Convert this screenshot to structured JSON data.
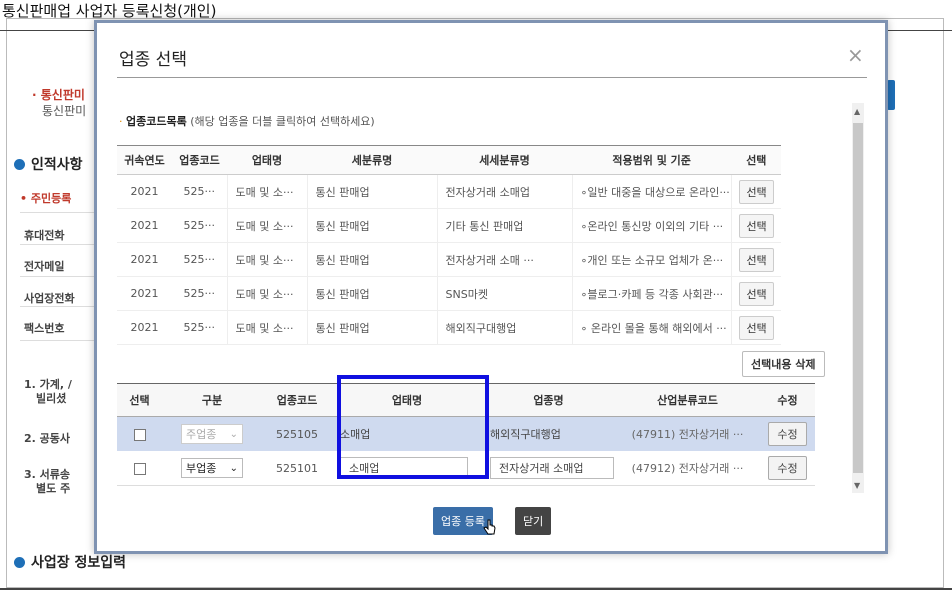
{
  "page": {
    "title": "통신판매업 사업자 등록신청(개인)",
    "bullet_red": "· 통신판미",
    "sub_text": "통신판미",
    "section_personal": "인적사항",
    "field_resident": "• 주민등록",
    "field_mobile": "휴대전화",
    "field_email": "전자메일",
    "field_phone": "사업장전화",
    "field_fax": "팩스번호",
    "note1": "1. 가계, /",
    "note1b": "빌리셨",
    "note2": "2. 공동사",
    "note3": "3. 서류송",
    "note3b": "별도 주",
    "section_business": "사업장 정보입력"
  },
  "modal": {
    "title": "업종 선택",
    "close_symbol": "×",
    "list_label": "업종코드목록",
    "list_hint": "(해당 업종을 더블 클릭하여 선택하세요)",
    "top_headers": [
      "귀속연도",
      "업종코드",
      "업태명",
      "세분류명",
      "세세분류명",
      "적용범위 및 기준",
      "선택"
    ],
    "top_rows": [
      {
        "year": "2021",
        "code": "525···",
        "type": "도매 및 소···",
        "sub": "통신 판매업",
        "subsub": "전자상거래 소매업",
        "scope": "∘일반 대중을 대상으로 온라인···",
        "btn": "선택"
      },
      {
        "year": "2021",
        "code": "525···",
        "type": "도매 및 소···",
        "sub": "통신 판매업",
        "subsub": "기타 통신 판매업",
        "scope": "∘온라인 통신망 이외의 기타 ···",
        "btn": "선택"
      },
      {
        "year": "2021",
        "code": "525···",
        "type": "도매 및 소···",
        "sub": "통신 판매업",
        "subsub": "전자상거래 소매 ···",
        "scope": "∘개인 또는 소규모 업체가 온···",
        "btn": "선택"
      },
      {
        "year": "2021",
        "code": "525···",
        "type": "도매 및 소···",
        "sub": "통신 판매업",
        "subsub": "SNS마켓",
        "scope": "∘블로그·카페 등 각종 사회관···",
        "btn": "선택"
      },
      {
        "year": "2021",
        "code": "525···",
        "type": "도매 및 소···",
        "sub": "통신 판매업",
        "subsub": "해외직구대행업",
        "scope": "∘ 온라인 몰을 통해 해외에서 ···",
        "btn": "선택"
      }
    ],
    "delete_label": "선택내용 삭제",
    "bottom_headers": [
      "선택",
      "구분",
      "업종코드",
      "업태명",
      "업종명",
      "산업분류코드",
      "수정"
    ],
    "bottom_rows": [
      {
        "kind": "주업종",
        "code": "525105",
        "type": "소매업",
        "name": "해외직구대행업",
        "industry": "(47911) 전자상거래 ···",
        "edit": "수정"
      },
      {
        "kind": "부업종",
        "code": "525101",
        "type": "소매업",
        "name": "전자상거래 소매업",
        "industry": "(47912) 전자상거래 ···",
        "edit": "수정"
      }
    ],
    "register_label": "업종 등록",
    "close_label": "닫기"
  },
  "colors": {
    "accent_blue": "#3a6ea8",
    "highlight": "#1010e0",
    "selected_row": "#cfdaef"
  }
}
